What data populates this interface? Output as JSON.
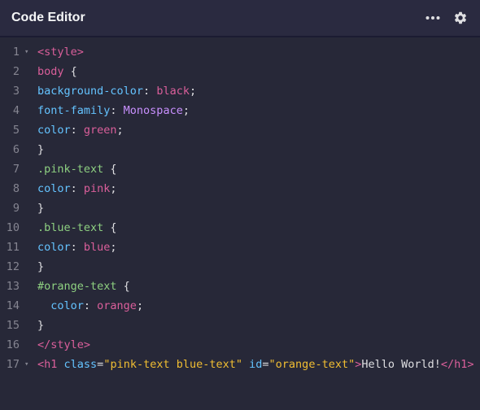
{
  "header": {
    "title": "Code Editor",
    "more_icon": "more-horizontal-icon",
    "settings_icon": "gear-icon"
  },
  "colors": {
    "background": "#272838",
    "header": "#2a2a40",
    "tag": "#db5f9b",
    "class_selector": "#8ed081",
    "property": "#64c3ff",
    "value": "#db5f9b",
    "string": "#f1be32",
    "line_number": "#858591"
  },
  "editor": {
    "lines": [
      {
        "num": "1",
        "fold": "▾",
        "tag_open": "<style>"
      },
      {
        "num": "2",
        "selector": "body",
        "brace": " {"
      },
      {
        "num": "3",
        "prop": "background-color",
        "colon": ": ",
        "value": "black",
        "semi": ";"
      },
      {
        "num": "4",
        "prop": "font-family",
        "colon": ": ",
        "value": "Monospace",
        "semi": ";"
      },
      {
        "num": "5",
        "prop": "color",
        "colon": ": ",
        "value": "green",
        "semi": ";"
      },
      {
        "num": "6",
        "brace": "}"
      },
      {
        "num": "7",
        "selector": ".pink-text",
        "brace": " {"
      },
      {
        "num": "8",
        "prop": "color",
        "colon": ": ",
        "value": "pink",
        "semi": ";"
      },
      {
        "num": "9",
        "brace": "}"
      },
      {
        "num": "10",
        "selector": ".blue-text",
        "brace": " {"
      },
      {
        "num": "11",
        "prop": "color",
        "colon": ": ",
        "value": "blue",
        "semi": ";"
      },
      {
        "num": "12",
        "brace": "}"
      },
      {
        "num": "13",
        "selector": "#orange-text",
        "brace": " {"
      },
      {
        "num": "14",
        "indent": "  ",
        "prop": "color",
        "colon": ": ",
        "value": "orange",
        "semi": ";"
      },
      {
        "num": "15",
        "brace": "}"
      },
      {
        "num": "16",
        "tag_open": "</style>"
      },
      {
        "num": "17",
        "fold": "▾",
        "h1_open": "<h1",
        "attr1": "class",
        "eq1": "=",
        "str1": "\"pink-text blue-text\"",
        "attr2": "id",
        "eq2": "=",
        "str2": "\"orange-text\"",
        "gt": ">",
        "text": "Hello World!",
        "h1_close": "</h1>"
      }
    ]
  }
}
